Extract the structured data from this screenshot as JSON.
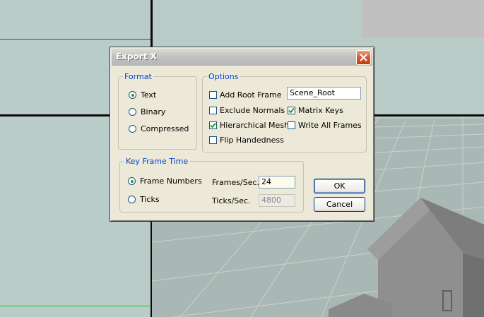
{
  "dialog": {
    "title": "Export X",
    "format": {
      "legend": "Format",
      "options": [
        "Text",
        "Binary",
        "Compressed"
      ],
      "selected": "Text"
    },
    "options_group": {
      "legend": "Options",
      "add_root_frame": {
        "label": "Add Root Frame",
        "checked": false
      },
      "root_frame_name": "Scene_Root",
      "exclude_normals": {
        "label": "Exclude Normals",
        "checked": false
      },
      "matrix_keys": {
        "label": "Matrix Keys",
        "checked": true
      },
      "hierarchical_mesh": {
        "label": "Hierarchical Mesh",
        "checked": true
      },
      "write_all_frames": {
        "label": "Write All Frames",
        "checked": false
      },
      "flip_handedness": {
        "label": "Flip Handedness",
        "checked": false
      }
    },
    "key_frame_time": {
      "legend": "Key Frame Time",
      "options": [
        "Frame Numbers",
        "Ticks"
      ],
      "selected": "Frame Numbers",
      "frames_label": "Frames/Sec.",
      "frames_value": "24",
      "ticks_label": "Ticks/Sec.",
      "ticks_value": "4800"
    },
    "ok_label": "OK",
    "cancel_label": "Cancel"
  },
  "colors": {
    "dialog_bg": "#ece9d8",
    "legend": "#0046d5",
    "close_button": "#d4542a",
    "viewport_bg": "#b9ccc7"
  }
}
